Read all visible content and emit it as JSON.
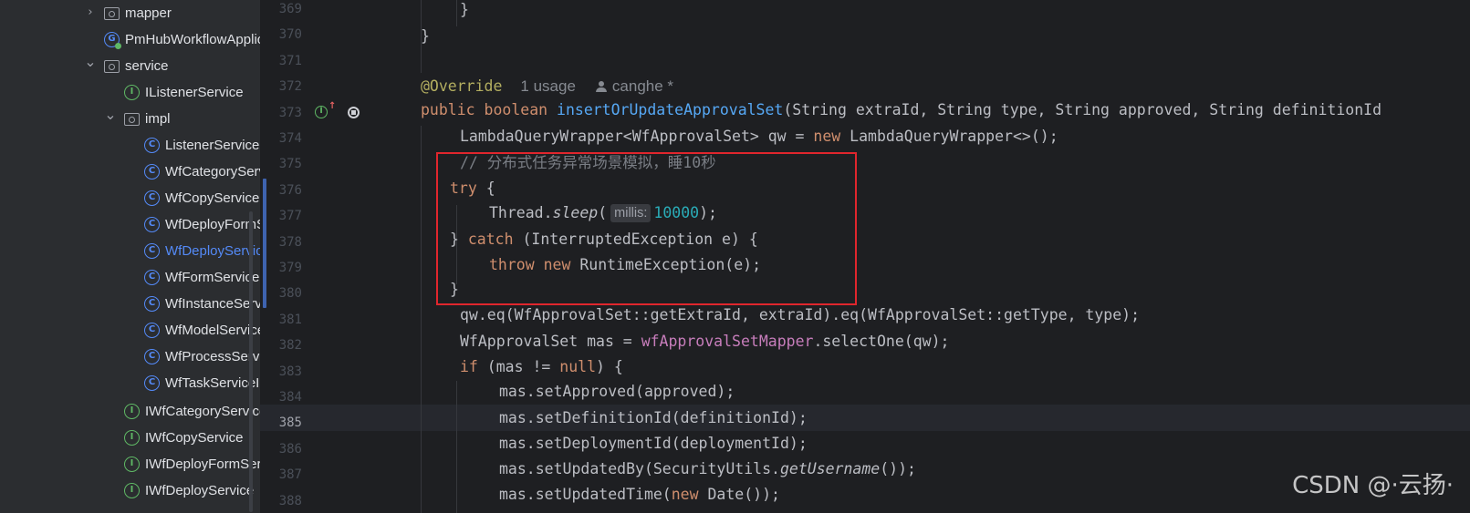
{
  "project_tree": {
    "items": [
      {
        "label": "mapper",
        "kind": "folder",
        "expanded": false,
        "has_chevron": true
      },
      {
        "label": "PmHubWorkflowApplication",
        "kind": "app-class",
        "has_chevron": false
      },
      {
        "label": "service",
        "kind": "folder",
        "expanded": true,
        "has_chevron": true
      },
      {
        "label": "IListenerService",
        "kind": "interface",
        "has_chevron": false
      },
      {
        "label": "impl",
        "kind": "folder",
        "expanded": true,
        "has_chevron": true
      },
      {
        "label": "ListenerServiceImpl",
        "kind": "class",
        "has_chevron": false
      },
      {
        "label": "WfCategoryServiceImpl",
        "kind": "class",
        "has_chevron": false
      },
      {
        "label": "WfCopyServiceImpl",
        "kind": "class",
        "has_chevron": false
      },
      {
        "label": "WfDeployFormServiceImpl",
        "kind": "class",
        "has_chevron": false
      },
      {
        "label": "WfDeployServiceImpl",
        "kind": "class",
        "active": true,
        "has_chevron": false
      },
      {
        "label": "WfFormServiceImpl",
        "kind": "class",
        "has_chevron": false
      },
      {
        "label": "WfInstanceServiceImpl",
        "kind": "class",
        "has_chevron": false
      },
      {
        "label": "WfModelServiceImpl",
        "kind": "class",
        "has_chevron": false
      },
      {
        "label": "WfProcessServiceImpl",
        "kind": "class",
        "has_chevron": false
      },
      {
        "label": "WfTaskServiceImpl",
        "kind": "class",
        "has_chevron": false
      },
      {
        "label": "IWfCategoryService",
        "kind": "interface",
        "has_chevron": false
      },
      {
        "label": "IWfCopyService",
        "kind": "interface",
        "has_chevron": false
      },
      {
        "label": "IWfDeployFormService",
        "kind": "interface",
        "has_chevron": false
      },
      {
        "label": "IWfDeployService",
        "kind": "interface",
        "has_chevron": false
      }
    ]
  },
  "editor": {
    "line_numbers": [
      "369",
      "370",
      "371",
      "372",
      "373",
      "374",
      "375",
      "376",
      "377",
      "378",
      "379",
      "380",
      "381",
      "382",
      "383",
      "384",
      "385",
      "386",
      "387",
      "388"
    ],
    "current_line": "385",
    "inlay": {
      "annotation": "@Override",
      "usages": "1 usage",
      "author": "canghe *"
    },
    "param_hint": "millis:",
    "code": {
      "l369": "}",
      "l370": "}",
      "l373_kw": "public boolean ",
      "l373_fn": "insertOrUpdateApprovalSet",
      "l373_rest": "(String extraId, String type, String approved, String definitionId",
      "l374_a": "LambdaQueryWrapper<WfApprovalSet> qw = ",
      "l374_kw": "new",
      "l374_b": " LambdaQueryWrapper<>();",
      "l375": "// 分布式任务异常场景模拟，睡10秒",
      "l376_kw": "try",
      "l376_b": " {",
      "l377_a": "Thread.",
      "l377_fn": "sleep",
      "l377_b": "(",
      "l377_num": "10000",
      "l377_c": ");",
      "l378_a": "} ",
      "l378_kw": "catch",
      "l378_b": " (InterruptedException e) {",
      "l379_kw": "throw new",
      "l379_b": " RuntimeException(e);",
      "l380": "}",
      "l381": "qw.eq(WfApprovalSet::getExtraId, extraId).eq(WfApprovalSet::getType, type);",
      "l382_a": "WfApprovalSet mas = ",
      "l382_field": "wfApprovalSetMapper",
      "l382_b": ".selectOne(qw);",
      "l383_kw": "if",
      "l383_a": " (mas != ",
      "l383_kw2": "null",
      "l383_b": ") {",
      "l384": "mas.setApproved(approved);",
      "l385": "mas.setDefinitionId(definitionId);",
      "l386": "mas.setDeploymentId(deploymentId);",
      "l387_a": "mas.setUpdatedBy(SecurityUtils.",
      "l387_fn": "getUsername",
      "l387_b": "());",
      "l388_a": "mas.setUpdatedTime(",
      "l388_kw": "new",
      "l388_b": " Date());"
    }
  },
  "watermark": "CSDN @·云扬·",
  "colors": {
    "keyword": "#cf8e6d",
    "annotation": "#b3ae60",
    "method": "#56a8f5",
    "number": "#2aacb8",
    "comment": "#7a7e85",
    "field": "#c77dbb",
    "highlight_box": "#e0262d"
  }
}
